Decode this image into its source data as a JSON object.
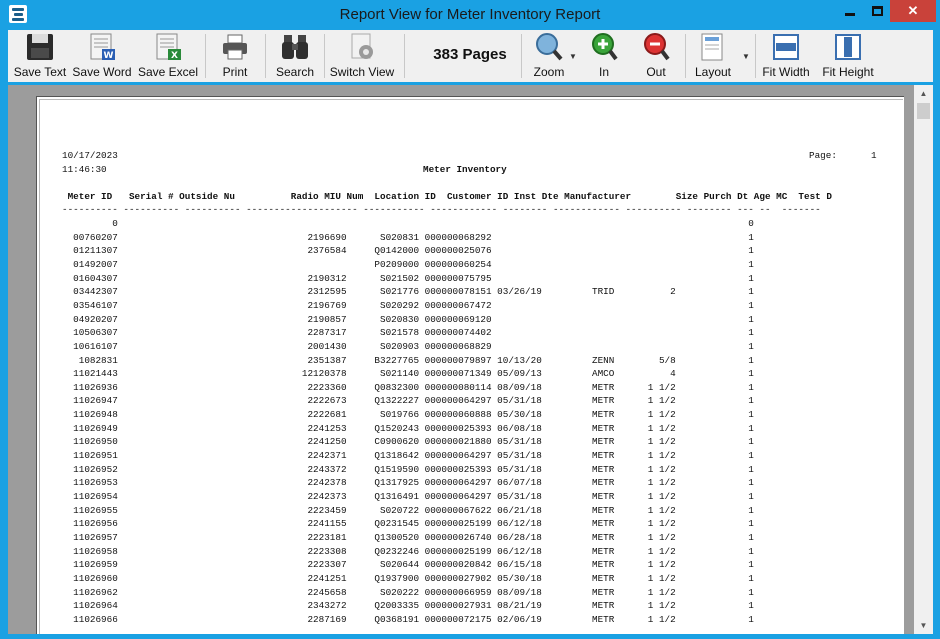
{
  "window": {
    "title": "Report View for Meter Inventory Report"
  },
  "toolbar": {
    "save_text": "Save Text",
    "save_word": "Save Word",
    "save_excel": "Save Excel",
    "print": "Print",
    "search": "Search",
    "switch_view": "Switch View",
    "pages": "383 Pages",
    "zoom": "Zoom",
    "zoom_in": "In",
    "zoom_out": "Out",
    "layout": "Layout",
    "fit_width": "Fit Width",
    "fit_height": "Fit Height"
  },
  "report": {
    "date": "10/17/2023",
    "time": "11:46:30",
    "title": "Meter Inventory",
    "page_label": "Page:",
    "page_number": "1",
    "header_line": " Meter ID   Serial # Outside Nu          Radio MIU Num  Location ID  Customer ID Inst Dte Manufacturer        Size Purch Dt Age MC  Test D",
    "dash_line": "---------- ---------- ---------- -------------------- ----------- ------------ -------- ------------ ---------- -------- --- --  -------",
    "rows": [
      "         0                                                                                                                 0",
      "  00760207                                  2196690      S020831 000000068292                                              1",
      "  01211307                                  2376584     Q0142000 000000025076                                              1",
      "  01492007                                              P0209000 000000060254                                              1",
      "  01604307                                  2190312      S021502 000000075795                                              1",
      "  03442307                                  2312595      S021776 000000078151 03/26/19         TRID          2             1",
      "  03546107                                  2196769      S020292 000000067472                                              1",
      "  04920207                                  2190857      S020830 000000069120                                              1",
      "  10506307                                  2287317      S021578 000000074402                                              1",
      "  10616107                                  2001430      S020903 000000068829                                              1",
      "   1082831                                  2351387     B3227765 000000079897 10/13/20         ZENN        5/8             1",
      "  11021443                                 12120378      S021140 000000071349 05/09/13         AMCO          4             1",
      "  11026936                                  2223360     Q0832300 000000080114 08/09/18         METR      1 1/2             1",
      "  11026947                                  2222673     Q1322227 000000064297 05/31/18         METR      1 1/2             1",
      "  11026948                                  2222681      S019766 000000060888 05/30/18         METR      1 1/2             1",
      "  11026949                                  2241253     Q1520243 000000025393 06/08/18         METR      1 1/2             1",
      "  11026950                                  2241250     C0900620 000000021880 05/31/18         METR      1 1/2             1",
      "  11026951                                  2242371     Q1318642 000000064297 05/31/18         METR      1 1/2             1",
      "  11026952                                  2243372     Q1519590 000000025393 05/31/18         METR      1 1/2             1",
      "  11026953                                  2242378     Q1317925 000000064297 06/07/18         METR      1 1/2             1",
      "  11026954                                  2242373     Q1316491 000000064297 05/31/18         METR      1 1/2             1",
      "  11026955                                  2223459      S020722 000000067622 06/21/18         METR      1 1/2             1",
      "  11026956                                  2241155     Q0231545 000000025199 06/12/18         METR      1 1/2             1",
      "  11026957                                  2223181     Q1300520 000000026740 06/28/18         METR      1 1/2             1",
      "  11026958                                  2223308     Q0232246 000000025199 06/12/18         METR      1 1/2             1",
      "  11026959                                  2223307      S020644 000000020842 06/15/18         METR      1 1/2             1",
      "  11026960                                  2241251     Q1937900 000000027902 05/30/18         METR      1 1/2             1",
      "  11026962                                  2245658      S020222 000000066959 08/09/18         METR      1 1/2             1",
      "  11026964                                  2343272     Q2003335 000000027931 08/21/19         METR      1 1/2             1",
      "  11026966                                  2287169     Q0368191 000000072175 02/06/19         METR      1 1/2             1"
    ]
  }
}
